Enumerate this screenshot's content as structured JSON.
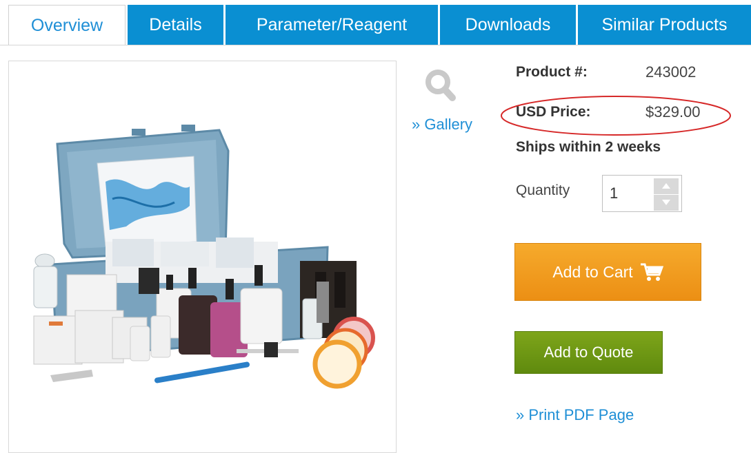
{
  "tabs": [
    {
      "label": "Overview",
      "active": true
    },
    {
      "label": "Details",
      "active": false
    },
    {
      "label": "Parameter/Reagent",
      "active": false
    },
    {
      "label": "Downloads",
      "active": false
    },
    {
      "label": "Similar Products",
      "active": false
    }
  ],
  "gallery": {
    "icon": "magnifier-icon",
    "link_label": "» Gallery"
  },
  "product": {
    "number_label": "Product #:",
    "number_value": "243002",
    "price_label": "USD Price:",
    "price_value": "$329.00",
    "price_highlight_color": "#d62828",
    "shipping": "Ships within 2 weeks"
  },
  "quantity": {
    "label": "Quantity",
    "value": "1"
  },
  "actions": {
    "add_to_cart": "Add to Cart",
    "cart_icon": "shopping-cart-icon",
    "add_to_quote": "Add to Quote",
    "print_pdf": "» Print PDF Page"
  },
  "colors": {
    "tab_blue": "#0a8fd2",
    "link_blue": "#1f8fd6",
    "cart_orange": "#ef9a1e",
    "quote_green": "#6f9914"
  }
}
